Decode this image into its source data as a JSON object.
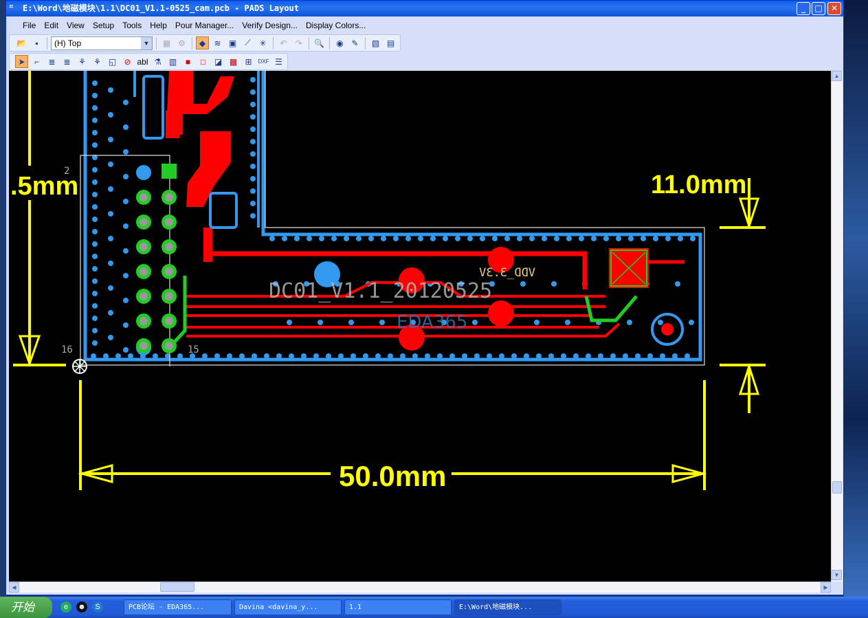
{
  "window": {
    "title": "E:\\Word\\地磁模块\\1.1\\DC01_V1.1-0525_cam.pcb - PADS Layout",
    "minimize": "_",
    "maximize": "□",
    "close": "✕"
  },
  "menu": [
    "File",
    "Edit",
    "View",
    "Setup",
    "Tools",
    "Help",
    "Pour Manager...",
    "Verify Design...",
    "Display Colors..."
  ],
  "toolbar": {
    "layer": "(H) Top"
  },
  "pcb": {
    "silk_version": "DC01_V1.1_20120525",
    "silk_vdd": "VDD_3.3V",
    "watermark": "EDA365",
    "pin_label_16": "16",
    "pin_label_15": "15",
    "pin_label_2": "2",
    "dim_left": ".5mm",
    "dim_height": "11.0mm",
    "dim_width": "50.0mm",
    "colors": {
      "copper_top": "#ff0000",
      "copper_fill": "#3399ee",
      "via_pad": "#22cc22",
      "dimension": "#ffff00"
    }
  },
  "taskbar": {
    "start": "开始",
    "tasks": [
      "PCB论坛 - EDA365...",
      "Davina <davina_y...",
      "1.1",
      "E:\\Word\\地磁模块..."
    ]
  }
}
